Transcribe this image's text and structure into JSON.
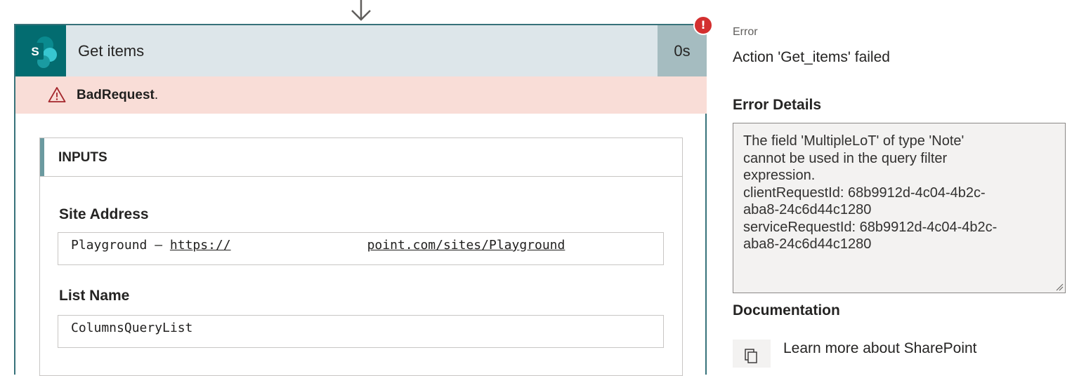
{
  "flow_card": {
    "title": "Get items",
    "duration": "0s",
    "connector_icon": "sharepoint-icon",
    "connector_icon_letter": "S",
    "error_badge": "!",
    "error_banner": "BadRequest",
    "error_banner_suffix": "."
  },
  "inputs": {
    "title": "INPUTS",
    "fields": [
      {
        "label": "Site Address",
        "value_prefix": "Playground – ",
        "value_link_start": "https://",
        "value_link_end": "point.com/sites/Playground"
      },
      {
        "label": "List Name",
        "value": "ColumnsQueryList"
      }
    ]
  },
  "side_panel": {
    "error_label": "Error",
    "error_message": "Action 'Get_items' failed",
    "error_details_heading": "Error Details",
    "error_details_lines": [
      "The field 'MultipleLoT' of type 'Note'",
      "cannot be used in the query filter",
      "expression.",
      "clientRequestId: 68b9912d-4c04-4b2c-",
      "aba8-24c6d44c1280",
      "serviceRequestId: 68b9912d-4c04-4b2c-",
      "aba8-24c6d44c1280"
    ],
    "documentation_heading": "Documentation",
    "documentation_link": "Learn more about SharePoint"
  },
  "colors": {
    "header_bg": "#dde6ea",
    "connector_bg": "#036c70",
    "error_banner_bg": "#f9ddd7",
    "error_badge": "#d32f2f"
  }
}
